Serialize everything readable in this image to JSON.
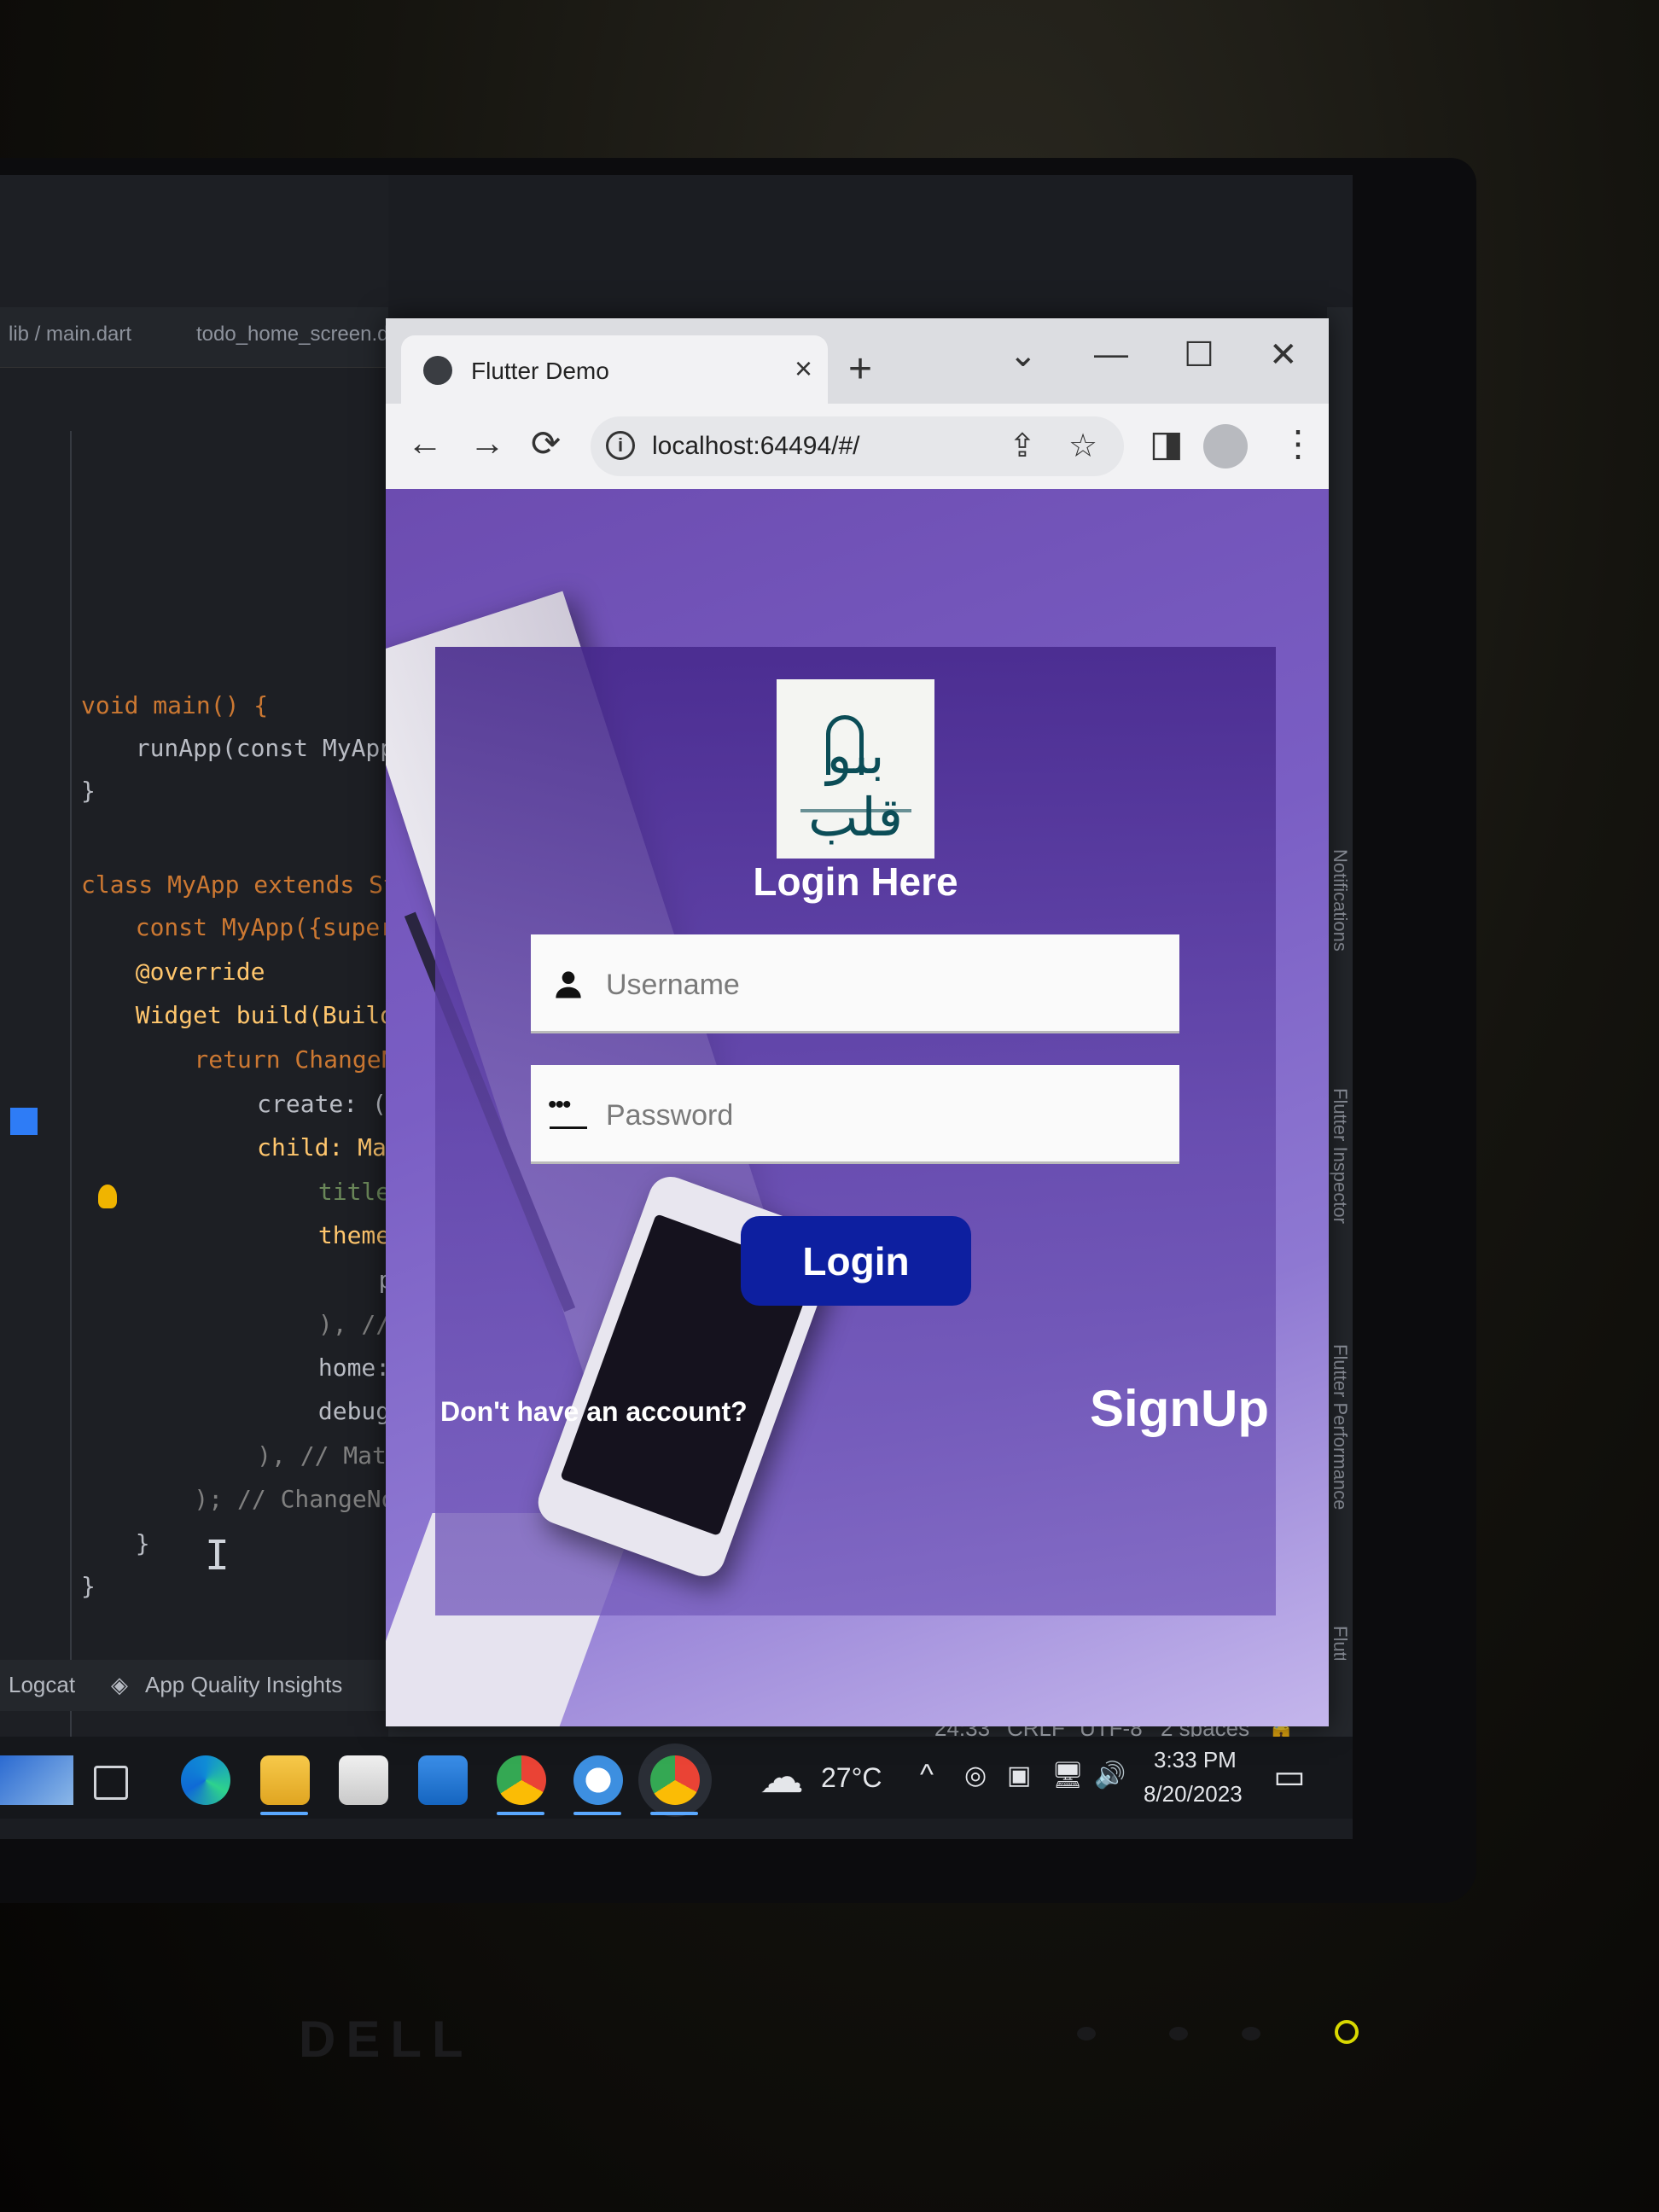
{
  "ide": {
    "tabs": [
      "lib / main.dart",
      "todo_home_screen.dart"
    ],
    "code_lines": [
      {
        "text": "void main() {"
      },
      {
        "text": "  runApp(const MyApp());"
      },
      {
        "text": "}"
      },
      {
        "text": "class MyApp extends StatelessWidget {"
      },
      {
        "text": "  const MyApp({super.key});"
      },
      {
        "text": "  @override"
      },
      {
        "text": "  Widget build(BuildContext context) {"
      },
      {
        "text": "    return ChangeNotifierProvider("
      },
      {
        "text": "      create: (context) => TodoProvider(),"
      },
      {
        "text": "      child: MaterialApp("
      },
      {
        "text": "        title: 'Flutter Demo',"
      },
      {
        "text": "        theme: ThemeData("
      },
      {
        "text": "          primarySwatch: Colors.blue,"
      },
      {
        "text": "        ), // ThemeData"
      },
      {
        "text": "        home: const LoginScreen(),"
      },
      {
        "text": "        debugShowCheckedModeBanner: false,"
      },
      {
        "text": "      ), // MaterialApp"
      },
      {
        "text": "    ); // ChangeNotifierProvider"
      },
      {
        "text": "  }"
      },
      {
        "text": "}"
      }
    ],
    "right_panels": [
      "Notifications",
      "Flutter Inspector",
      "Flutter Performance",
      "Flutter Outline"
    ],
    "bottom_tools": [
      "Logcat",
      "App Quality Insights"
    ],
    "status": {
      "position": "24:33",
      "line_ending": "CRLF",
      "encoding": "UTF-8",
      "indent": "2 spaces"
    }
  },
  "browser": {
    "tab_title": "Flutter Demo",
    "tab_close": "×",
    "new_tab": "+",
    "url": "localhost:64494/#/",
    "window_controls": {
      "dropdown": "⌄",
      "minimize": "—",
      "maximize": "☐",
      "close": "✕"
    },
    "nav": {
      "back": "←",
      "forward": "→",
      "reload": "⟳",
      "share": "⇪",
      "star": "☆",
      "sidepanel": "◨",
      "menu": "⋮"
    }
  },
  "app": {
    "logo_text": "بنو قلب",
    "title": "Login Here",
    "username_placeholder": "Username",
    "password_placeholder": "Password",
    "password_dots": "•••",
    "login_button": "Login",
    "no_account_text": "Don't have an account?",
    "signup_link": "SignUp",
    "colors": {
      "button": "#0d1fa0",
      "card": "#4a2c8c",
      "background": "#7a5ec4"
    }
  },
  "taskbar": {
    "apps": [
      "pen-app-icon",
      "task-view-icon",
      "edge-icon",
      "file-explorer-icon",
      "store-icon",
      "mail-icon",
      "chrome-icon",
      "android-studio-icon",
      "chrome-icon"
    ],
    "weather": "27°C",
    "time": "3:33 PM",
    "date": "8/20/2023"
  },
  "monitor": {
    "brand": "DELL"
  }
}
